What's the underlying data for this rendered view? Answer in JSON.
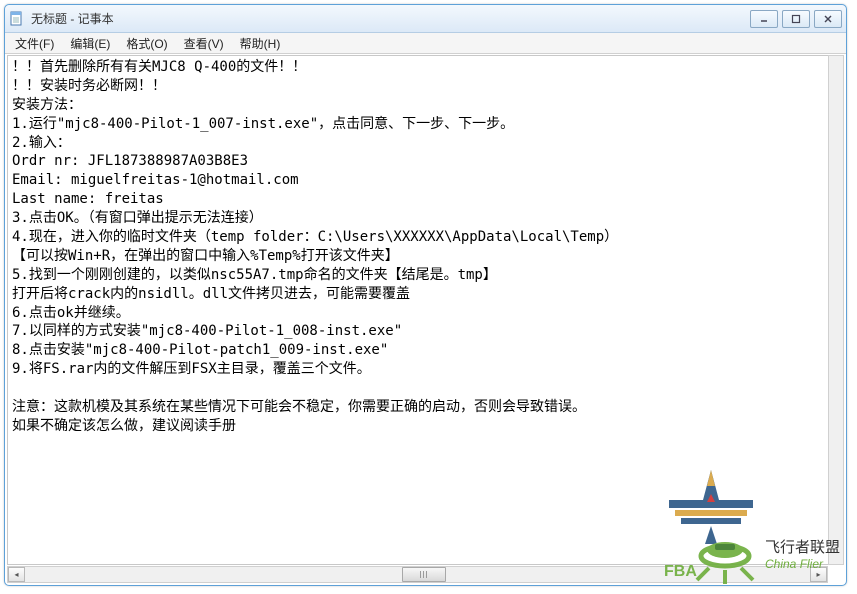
{
  "window": {
    "title": "无标题 - 记事本",
    "controls": {
      "min": "minimize",
      "max": "maximize",
      "close": "close"
    }
  },
  "menu": {
    "file": "文件(F)",
    "edit": "编辑(E)",
    "format": "格式(O)",
    "view": "查看(V)",
    "help": "帮助(H)"
  },
  "document": {
    "body": "！！首先删除所有有关MJC8 Q-400的文件！！\n！！安装时务必断网！！\n安装方法：\n1.运行\"mjc8-400-Pilot-1_007-inst.exe\"，点击同意、下一步、下一步。\n2.输入：\nOrdr nr: JFL187388987A03B8E3\nEmail: miguelfreitas-1@hotmail.com\nLast name: freitas\n3.点击OK。（有窗口弹出提示无法连接）\n4.现在，进入你的临时文件夹（temp folder：C:\\Users\\XXXXXX\\AppData\\Local\\Temp）\n【可以按Win+R，在弹出的窗口中输入%Temp%打开该文件夹】\n5.找到一个刚刚创建的，以类似nsc55A7.tmp命名的文件夹【结尾是。tmp】\n打开后将crack内的nsidll。dll文件拷贝进去，可能需要覆盖\n6.点击ok并继续。\n7.以同样的方式安装\"mjc8-400-Pilot-1_008-inst.exe\"\n8.点击安装\"mjc8-400-Pilot-patch1_009-inst.exe\"\n9.将FS.rar内的文件解压到FSX主目录，覆盖三个文件。\n\n注意：这款机模及其系统在某些情况下可能会不稳定，你需要正确的启动，否则会导致错误。\n如果不确定该怎么做，建议阅读手册"
  },
  "watermark": {
    "line1": "飞行者联盟",
    "line2": "China Flier"
  }
}
